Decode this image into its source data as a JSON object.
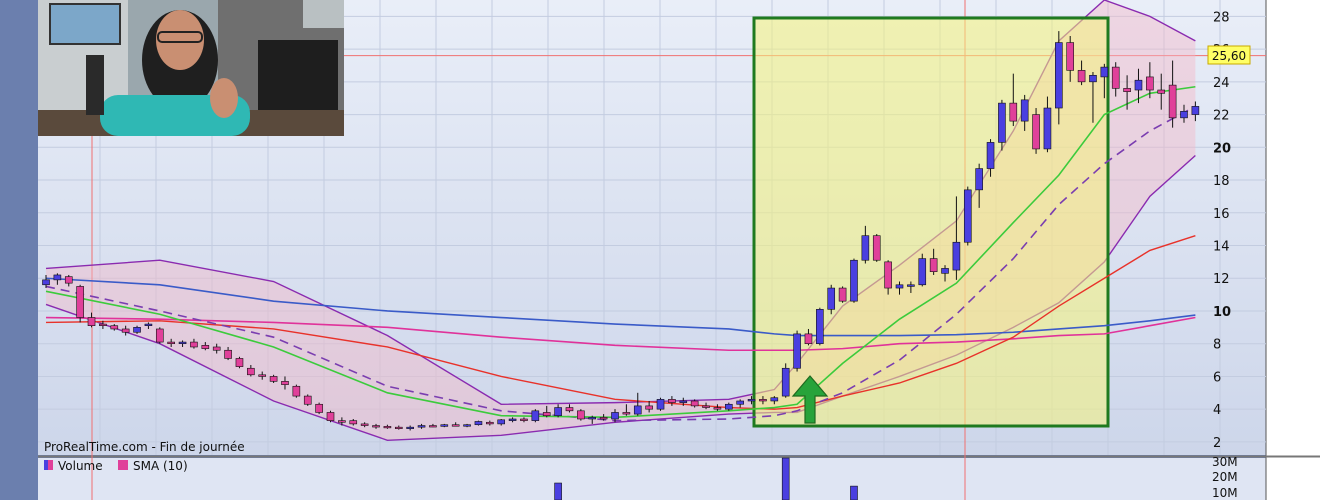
{
  "watermark": "ProRealTime.com - Fin de journée",
  "price_label": "25,60",
  "volume_legend": {
    "volume": "Volume",
    "sma": "SMA (10)"
  },
  "colors": {
    "bull": "#4a3fe0",
    "bear": "#e0409a",
    "box": "#1f7a1f",
    "arrow": "#27a33a",
    "bb": "#8a2bb0",
    "sma_green": "#3ccb3c",
    "sma_red": "#e8322a",
    "sma_blue": "#3a5bc8",
    "sma_pink": "#e0329a",
    "sma_dash": "#7a3db0"
  },
  "chart_data": {
    "type": "candlestick",
    "y_ticks": [
      2,
      4,
      6,
      8,
      10,
      12,
      14,
      16,
      18,
      20,
      22,
      24,
      26,
      28
    ],
    "y_tick_labels": [
      "2",
      "4",
      "6",
      "8",
      "10",
      "12",
      "14",
      "16",
      "18",
      "20",
      "22",
      "24",
      "26",
      "28"
    ],
    "ylim": [
      1.2,
      29
    ],
    "current_price": 25.6,
    "candles": [
      [
        11.6,
        12.2,
        11.4,
        11.9
      ],
      [
        11.9,
        12.3,
        11.6,
        12.2
      ],
      [
        12.1,
        12.2,
        11.5,
        11.7
      ],
      [
        11.5,
        11.6,
        9.3,
        9.6
      ],
      [
        9.6,
        9.9,
        9.0,
        9.1
      ],
      [
        9.2,
        9.4,
        8.9,
        9.1
      ],
      [
        9.1,
        9.2,
        8.8,
        8.9
      ],
      [
        8.9,
        9.1,
        8.5,
        8.7
      ],
      [
        8.7,
        9.1,
        8.6,
        9.0
      ],
      [
        9.1,
        9.3,
        8.9,
        9.2
      ],
      [
        8.9,
        9.0,
        8.0,
        8.1
      ],
      [
        8.1,
        8.3,
        7.8,
        8.0
      ],
      [
        8.0,
        8.2,
        7.8,
        8.1
      ],
      [
        8.1,
        8.3,
        7.7,
        7.8
      ],
      [
        7.9,
        8.1,
        7.6,
        7.7
      ],
      [
        7.8,
        8.0,
        7.4,
        7.6
      ],
      [
        7.6,
        7.8,
        7.0,
        7.1
      ],
      [
        7.1,
        7.2,
        6.5,
        6.6
      ],
      [
        6.5,
        6.7,
        6.0,
        6.1
      ],
      [
        6.1,
        6.3,
        5.8,
        6.0
      ],
      [
        6.0,
        6.1,
        5.6,
        5.7
      ],
      [
        5.7,
        6.0,
        5.2,
        5.5
      ],
      [
        5.4,
        5.5,
        4.7,
        4.8
      ],
      [
        4.8,
        4.9,
        4.2,
        4.3
      ],
      [
        4.3,
        4.4,
        3.7,
        3.8
      ],
      [
        3.8,
        3.9,
        3.2,
        3.3
      ],
      [
        3.3,
        3.5,
        3.0,
        3.2
      ],
      [
        3.3,
        3.4,
        3.0,
        3.1
      ],
      [
        3.1,
        3.2,
        2.9,
        3.0
      ],
      [
        3.0,
        3.1,
        2.8,
        2.95
      ],
      [
        2.95,
        3.05,
        2.8,
        2.9
      ],
      [
        2.9,
        3.0,
        2.75,
        2.85
      ],
      [
        2.85,
        3.0,
        2.7,
        2.9
      ],
      [
        2.9,
        3.1,
        2.8,
        3.0
      ],
      [
        3.0,
        3.1,
        2.9,
        2.95
      ],
      [
        2.95,
        3.1,
        2.9,
        3.05
      ],
      [
        3.05,
        3.2,
        2.95,
        3.0
      ],
      [
        3.0,
        3.1,
        2.9,
        3.05
      ],
      [
        3.05,
        3.3,
        3.0,
        3.25
      ],
      [
        3.2,
        3.3,
        3.0,
        3.1
      ],
      [
        3.1,
        3.4,
        3.0,
        3.35
      ],
      [
        3.3,
        3.5,
        3.2,
        3.4
      ],
      [
        3.4,
        3.5,
        3.2,
        3.3
      ],
      [
        3.3,
        4.0,
        3.2,
        3.9
      ],
      [
        3.8,
        4.2,
        3.5,
        3.6
      ],
      [
        3.6,
        4.3,
        3.5,
        4.1
      ],
      [
        4.1,
        4.3,
        3.8,
        3.9
      ],
      [
        3.9,
        4.0,
        3.3,
        3.4
      ],
      [
        3.4,
        3.6,
        3.1,
        3.5
      ],
      [
        3.5,
        3.7,
        3.3,
        3.4
      ],
      [
        3.4,
        4.0,
        3.2,
        3.8
      ],
      [
        3.8,
        4.3,
        3.6,
        3.7
      ],
      [
        3.7,
        5.0,
        3.6,
        4.2
      ],
      [
        4.2,
        4.5,
        3.8,
        4.0
      ],
      [
        4.0,
        4.7,
        3.9,
        4.6
      ],
      [
        4.6,
        4.8,
        4.2,
        4.4
      ],
      [
        4.4,
        4.7,
        4.2,
        4.5
      ],
      [
        4.5,
        4.6,
        4.1,
        4.2
      ],
      [
        4.2,
        4.4,
        4.0,
        4.1
      ],
      [
        4.1,
        4.3,
        3.9,
        4.0
      ],
      [
        4.0,
        4.4,
        3.9,
        4.3
      ],
      [
        4.3,
        4.6,
        4.1,
        4.5
      ],
      [
        4.5,
        4.8,
        4.3,
        4.6
      ],
      [
        4.6,
        4.8,
        4.3,
        4.5
      ],
      [
        4.5,
        4.8,
        4.3,
        4.7
      ],
      [
        4.8,
        6.8,
        4.7,
        6.5
      ],
      [
        6.5,
        8.8,
        6.3,
        8.6
      ],
      [
        8.6,
        8.9,
        7.9,
        8.0
      ],
      [
        8.0,
        10.2,
        7.9,
        10.1
      ],
      [
        10.1,
        11.6,
        9.8,
        11.4
      ],
      [
        11.4,
        11.5,
        10.5,
        10.6
      ],
      [
        10.6,
        13.2,
        10.5,
        13.1
      ],
      [
        13.1,
        15.2,
        12.9,
        14.6
      ],
      [
        14.6,
        14.7,
        13.0,
        13.1
      ],
      [
        13.0,
        13.1,
        11.0,
        11.4
      ],
      [
        11.4,
        11.8,
        11.0,
        11.6
      ],
      [
        11.5,
        11.8,
        11.1,
        11.6
      ],
      [
        11.6,
        13.5,
        11.5,
        13.2
      ],
      [
        13.2,
        13.8,
        12.2,
        12.4
      ],
      [
        12.3,
        12.8,
        11.8,
        12.6
      ],
      [
        12.5,
        17.0,
        11.9,
        14.2
      ],
      [
        14.2,
        17.6,
        14.0,
        17.4
      ],
      [
        17.4,
        19.0,
        16.3,
        18.7
      ],
      [
        18.7,
        20.5,
        18.2,
        20.3
      ],
      [
        20.3,
        22.9,
        19.8,
        22.7
      ],
      [
        22.7,
        24.5,
        21.3,
        21.6
      ],
      [
        21.6,
        23.2,
        21.0,
        22.9
      ],
      [
        22.0,
        22.4,
        19.6,
        19.9
      ],
      [
        19.9,
        23.1,
        19.7,
        22.4
      ],
      [
        22.4,
        27.1,
        21.4,
        26.4
      ],
      [
        26.4,
        26.8,
        24.0,
        24.7
      ],
      [
        24.7,
        25.3,
        23.8,
        24.0
      ],
      [
        24.0,
        24.6,
        21.5,
        24.4
      ],
      [
        24.3,
        25.1,
        23.0,
        24.9
      ],
      [
        24.9,
        25.2,
        23.1,
        23.6
      ],
      [
        23.6,
        24.4,
        22.3,
        23.4
      ],
      [
        23.5,
        24.8,
        22.7,
        24.1
      ],
      [
        24.3,
        25.2,
        23.0,
        23.5
      ],
      [
        23.5,
        24.5,
        22.3,
        23.3
      ],
      [
        23.8,
        25.3,
        21.2,
        21.8
      ],
      [
        21.8,
        22.6,
        21.5,
        22.2
      ],
      [
        22.0,
        22.8,
        21.6,
        22.5
      ]
    ],
    "bands": {
      "x_candle_index": [
        0,
        10,
        20,
        30,
        40,
        50,
        60,
        64,
        66,
        70,
        75,
        80,
        85,
        89,
        93,
        97,
        101
      ],
      "bb_upper": [
        12.6,
        13.1,
        11.8,
        8.5,
        4.3,
        4.4,
        4.6,
        5.2,
        6.8,
        10.3,
        12.8,
        15.5,
        21.0,
        26.5,
        29.0,
        28.0,
        26.5
      ],
      "bb_lower": [
        10.4,
        8.0,
        4.5,
        2.1,
        2.4,
        3.2,
        3.7,
        3.8,
        3.8,
        4.8,
        6.0,
        7.3,
        9.0,
        10.5,
        13.0,
        17.0,
        19.5
      ],
      "sma_green": [
        11.2,
        9.8,
        7.8,
        5.0,
        3.6,
        3.5,
        3.9,
        4.1,
        4.3,
        6.8,
        9.5,
        11.7,
        15.4,
        18.3,
        22.0,
        23.3,
        23.7
      ],
      "sma_dash": [
        11.5,
        10.0,
        8.4,
        5.4,
        3.9,
        3.3,
        3.4,
        3.6,
        3.9,
        5.0,
        7.0,
        9.8,
        13.2,
        16.5,
        19.0,
        21.0,
        22.5
      ],
      "sma_red": [
        9.3,
        9.4,
        8.9,
        7.8,
        6.0,
        4.6,
        4.1,
        4.0,
        4.1,
        4.8,
        5.6,
        6.8,
        8.4,
        10.3,
        12.0,
        13.7,
        14.6
      ],
      "sma_blue": [
        12.0,
        11.6,
        10.6,
        10.0,
        9.6,
        9.2,
        8.9,
        8.6,
        8.5,
        8.5,
        8.5,
        8.55,
        8.7,
        8.9,
        9.1,
        9.4,
        9.75
      ],
      "sma_pink": [
        9.6,
        9.5,
        9.3,
        9.0,
        8.4,
        7.9,
        7.6,
        7.6,
        7.6,
        7.7,
        8.0,
        8.1,
        8.3,
        8.5,
        8.6,
        9.1,
        9.6
      ]
    },
    "volume_ticks": [
      "30M",
      "20M",
      "10M"
    ],
    "volume_spikes": [
      {
        "candle_index": 65,
        "value_millions": 32
      },
      {
        "candle_index": 45,
        "value_millions": 11
      },
      {
        "candle_index": 71,
        "value_millions": 9
      }
    ]
  }
}
